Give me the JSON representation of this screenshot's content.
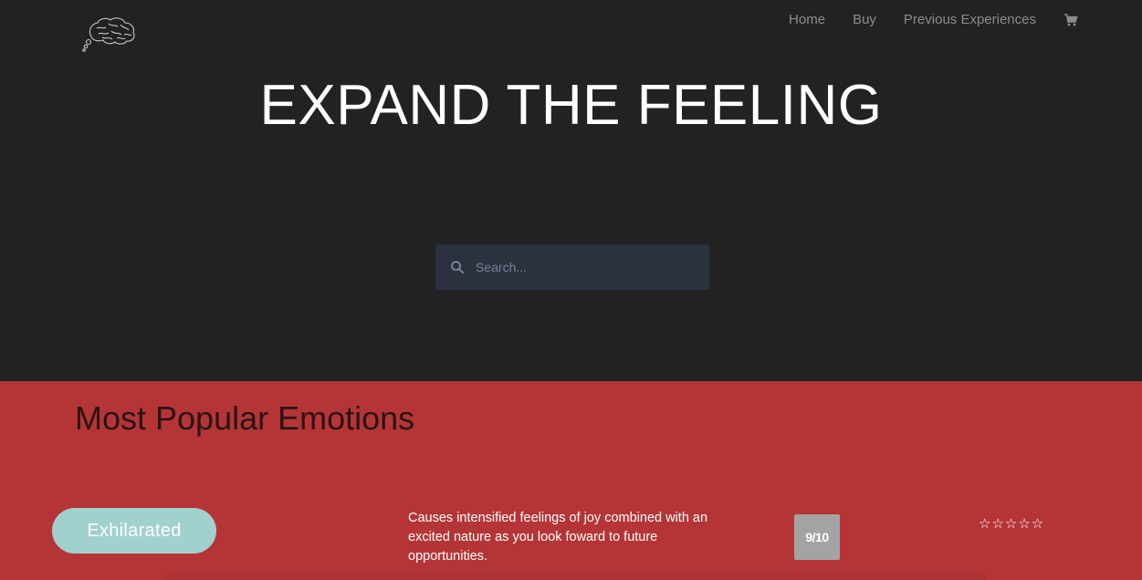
{
  "nav": {
    "items": [
      {
        "label": "Home"
      },
      {
        "label": "Buy"
      },
      {
        "label": "Previous Experiences"
      }
    ],
    "cart_icon": "shopping-cart-icon"
  },
  "logo": {
    "icon": "brain-thought-bubble-logo"
  },
  "hero": {
    "title": "EXPAND THE FEELING"
  },
  "search": {
    "placeholder": "Search...",
    "value": "",
    "icon": "search-icon"
  },
  "popular": {
    "title": "Most Popular Emotions",
    "emotions": [
      {
        "name": "Exhilarated",
        "description": "Causes intensified feelings of joy combined with an excited nature as you look foward to future opportunities.",
        "score": "9/10",
        "rating_stars": "☆☆☆☆☆"
      }
    ]
  },
  "colors": {
    "hero_background": "#222222",
    "section_background": "#b53537",
    "pill_background": "#a1d1cd",
    "search_background": "#2c3140",
    "badge_background": "#a3a3a3"
  }
}
